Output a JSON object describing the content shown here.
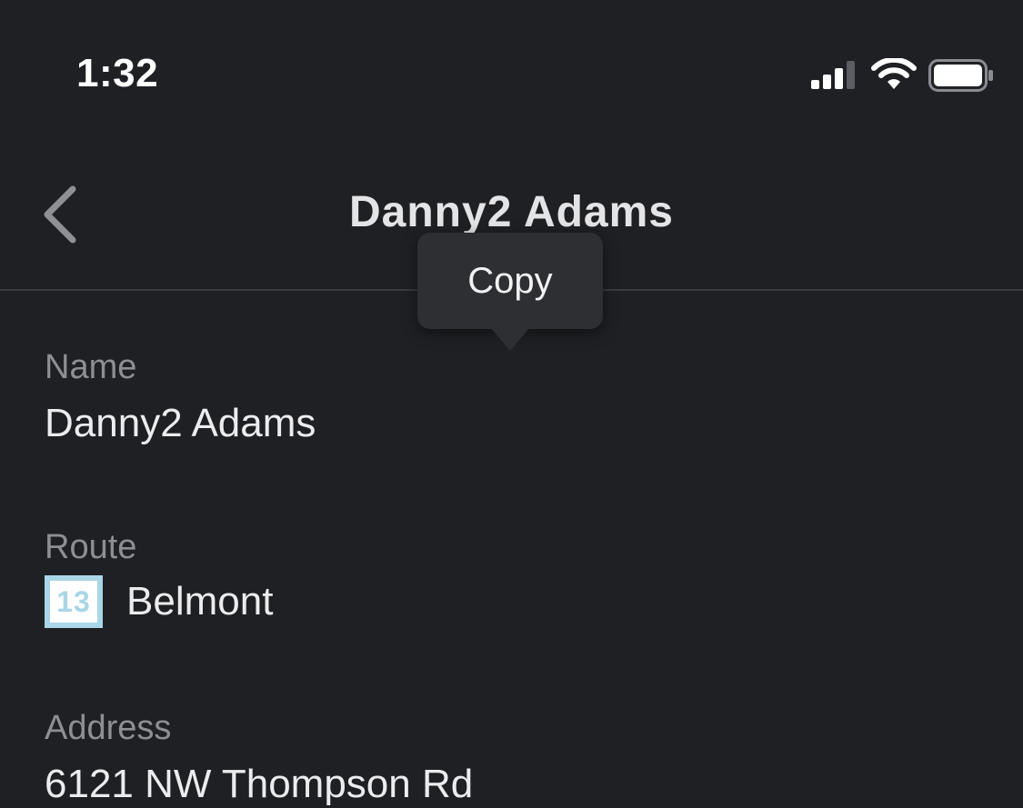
{
  "status_bar": {
    "time": "1:32",
    "icons": [
      "signal-icon",
      "wifi-icon",
      "battery-icon"
    ]
  },
  "nav": {
    "title": "Danny2 Adams",
    "back_icon": "chevron-left-icon"
  },
  "context_menu": {
    "copy_label": "Copy"
  },
  "fields": {
    "name": {
      "label": "Name",
      "value": "Danny2 Adams"
    },
    "route": {
      "label": "Route",
      "badge_number": "13",
      "value": "Belmont"
    },
    "address": {
      "label": "Address",
      "value": "6121 NW Thompson Rd"
    }
  },
  "colors": {
    "background": "#1f2024",
    "label": "#8e8f95",
    "text": "#ececee",
    "route_badge": "#a8d6e6",
    "menu": "#2e2f33"
  }
}
